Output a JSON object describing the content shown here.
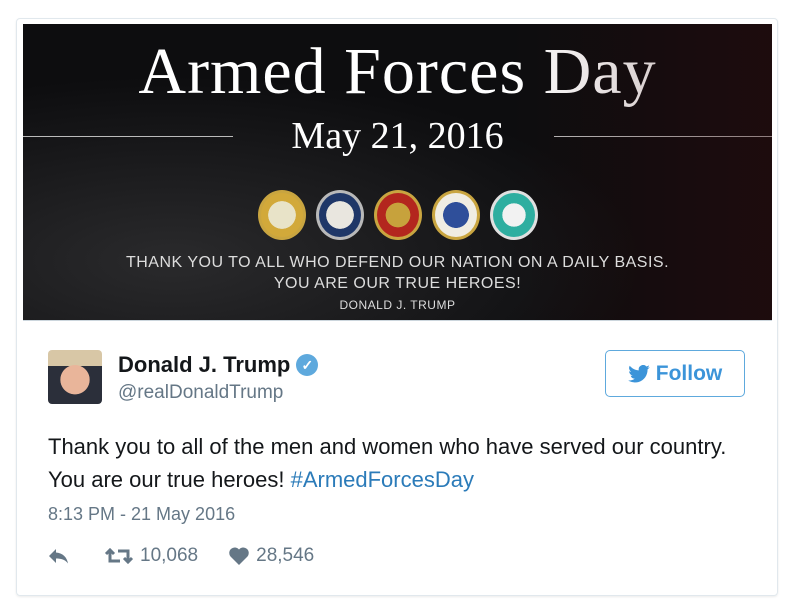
{
  "banner": {
    "title": "Armed Forces Day",
    "date": "May 21, 2016",
    "message_line1": "THANK YOU TO ALL WHO DEFEND OUR NATION ON A DAILY BASIS.",
    "message_line2": "YOU ARE OUR TRUE HEROES!",
    "signature": "DONALD J. TRUMP",
    "seals": [
      "army",
      "navy",
      "marine-corps",
      "air-force",
      "coast-guard"
    ]
  },
  "tweet": {
    "name": "Donald J. Trump",
    "handle": "@realDonaldTrump",
    "verified_icon": "check",
    "follow_label": "Follow",
    "text": "Thank you to all of the men and women who have served our country. You are our true heroes! ",
    "hashtag": "#ArmedForcesDay",
    "timestamp": "8:13 PM - 21 May 2016",
    "retweets": "10,068",
    "likes": "28,546"
  },
  "colors": {
    "link": "#2b7bb9",
    "follow": "#3b94d9",
    "verified": "#5ea9dd",
    "muted": "#657786"
  }
}
